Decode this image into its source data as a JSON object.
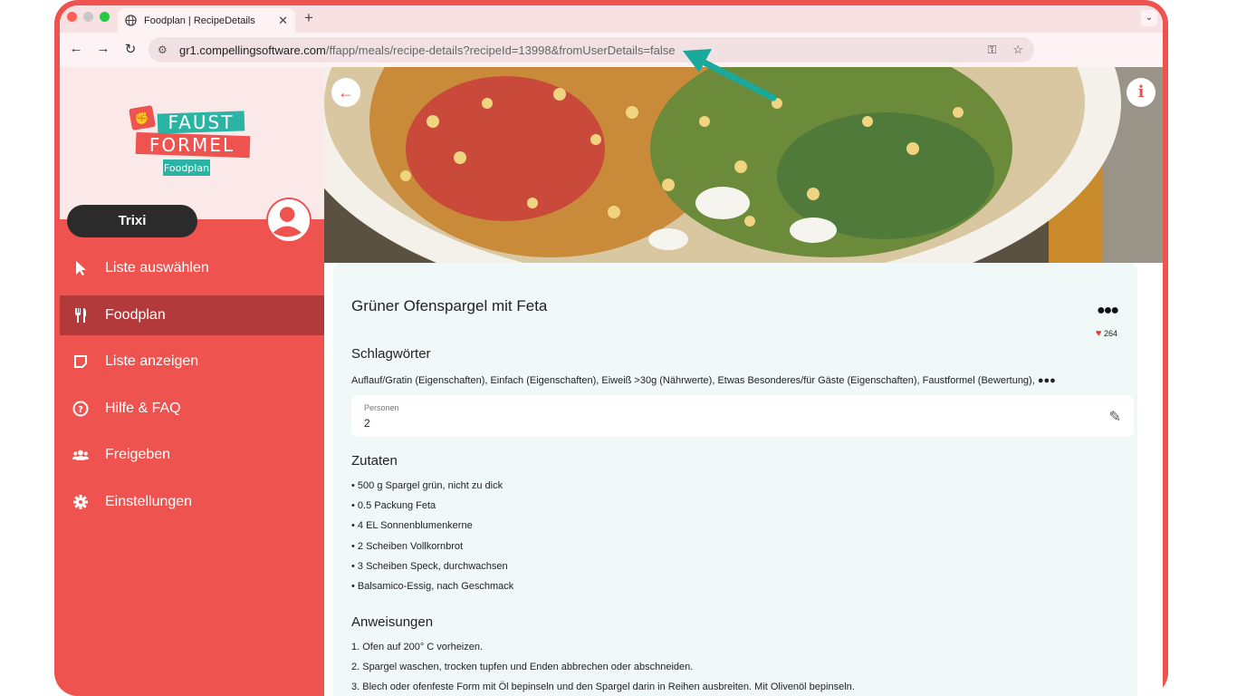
{
  "browser": {
    "tab_title": "Foodplan | RecipeDetails",
    "tab_close": "✕",
    "new_tab": "+",
    "url_host": "gr1.compellingsoftware.com",
    "url_path": "/ffapp/meals/recipe-details?recipeId=13998&fromUserDetails=false"
  },
  "sidebar": {
    "logo_line1": "FAUST",
    "logo_line2": "FORMEL",
    "logo_line3": "Foodplan",
    "user_name": "Trixi",
    "items": [
      {
        "label": "Liste auswählen",
        "icon": "cursor-icon"
      },
      {
        "label": "Foodplan",
        "icon": "utensils-icon",
        "active": true
      },
      {
        "label": "Liste anzeigen",
        "icon": "note-icon"
      },
      {
        "label": "Hilfe & FAQ",
        "icon": "question-icon"
      },
      {
        "label": "Freigeben",
        "icon": "users-icon"
      },
      {
        "label": "Einstellungen",
        "icon": "gear-icon"
      }
    ]
  },
  "recipe": {
    "title": "Grüner Ofenspargel mit Feta",
    "likes": "264",
    "tags_heading": "Schlagwörter",
    "tags": "Auflauf/Gratin (Eigenschaften), Einfach (Eigenschaften), Eiweiß >30g (Nährwerte), Etwas Besonderes/für Gäste (Eigenschaften), Faustformel (Bewertung),",
    "persons_label": "Personen",
    "persons_value": "2",
    "ingredients_heading": "Zutaten",
    "ingredients": [
      "• 500 g Spargel grün, nicht zu dick",
      "• 0.5 Packung Feta",
      "• 4 EL Sonnenblumenkerne",
      "• 2 Scheiben Vollkornbrot",
      "• 3 Scheiben Speck, durchwachsen",
      "• Balsamico-Essig, nach Geschmack"
    ],
    "instructions_heading": "Anweisungen",
    "instructions": [
      "1. Ofen auf 200° C vorheizen.",
      "2. Spargel waschen, trocken tupfen und Enden abbrechen oder abschneiden.",
      "3. Blech oder ofenfeste Form mit Öl bepinseln und den Spargel darin in Reihen ausbreiten. Mit Olivenöl bepinseln."
    ]
  },
  "colors": {
    "accent": "#ef5350",
    "active_item": "#b23a3a",
    "annotation_arrow": "#1aa99a"
  }
}
